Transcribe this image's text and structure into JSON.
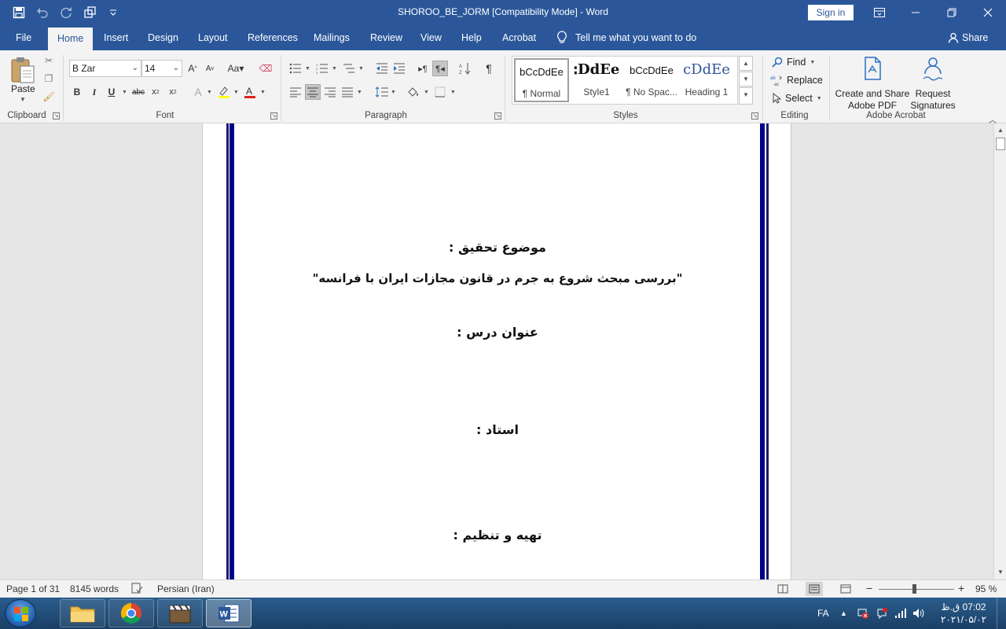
{
  "window": {
    "title": "SHOROO_BE_JORM [Compatibility Mode]  -  Word",
    "signin": "Sign in"
  },
  "qat": {
    "icons": [
      "save-icon",
      "undo-icon",
      "redo-icon",
      "touch-mode-icon",
      "customize-icon"
    ]
  },
  "tabs": [
    "File",
    "Home",
    "Insert",
    "Design",
    "Layout",
    "References",
    "Mailings",
    "Review",
    "View",
    "Help",
    "Acrobat"
  ],
  "tellme": "Tell me what you want to do",
  "share": "Share",
  "ribbon": {
    "clipboard": {
      "paste": "Paste",
      "label": "Clipboard"
    },
    "font": {
      "name": "B Zar",
      "size": "14",
      "label": "Font"
    },
    "paragraph": {
      "label": "Paragraph"
    },
    "styles": {
      "label": "Styles",
      "items": [
        {
          "sample": "bCcDdEe",
          "name": "¶ Normal"
        },
        {
          "sample": "ꓽDdEe",
          "name": "Style1"
        },
        {
          "sample": "bCcDdEe",
          "name": "¶ No Spac..."
        },
        {
          "sample": "cDdEe",
          "name": "Heading 1"
        }
      ]
    },
    "editing": {
      "label": "Editing",
      "find": "Find",
      "replace": "Replace",
      "select": "Select"
    },
    "acrobat": {
      "label": "Adobe Acrobat",
      "create": "Create and Share\nAdobe PDF",
      "create_l1": "Create and Share",
      "create_l2": "Adobe PDF",
      "request_l1": "Request",
      "request_l2": "Signatures"
    }
  },
  "document": {
    "line1": "موضوع تحقیق :",
    "line2": "\"بررسی مبحث شروع به جرم در قانون مجازات ایران با فرانسه\"",
    "line3": "عنوان درس :",
    "line4": "استاد :",
    "line5": "تهیه و تنظیم :"
  },
  "status": {
    "page": "Page 1 of 31",
    "words": "8145 words",
    "language": "Persian (Iran)",
    "zoom": "95 %",
    "zoom_value": 95
  },
  "taskbar": {
    "lang": "FA",
    "time": "07:02 ق.ظ",
    "date": "۲۰۲۱/۰۵/۰۲"
  },
  "colors": {
    "accent": "#2b579a",
    "page_border": "#00008b"
  }
}
